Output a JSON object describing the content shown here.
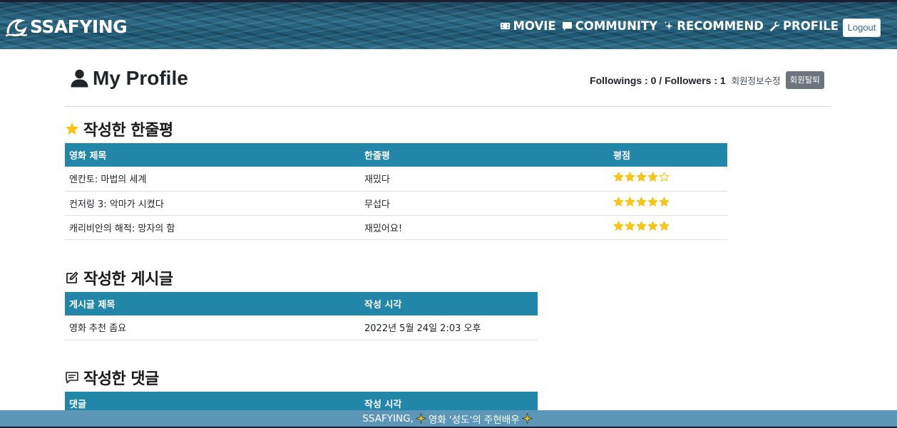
{
  "navbar": {
    "brand": "SSAFYING",
    "links": [
      {
        "label": "MOVIE",
        "icon": "film-icon"
      },
      {
        "label": "COMMUNITY",
        "icon": "chat-icon"
      },
      {
        "label": "RECOMMEND",
        "icon": "sparkle-icon"
      },
      {
        "label": "PROFILE",
        "icon": "wrench-icon"
      }
    ],
    "logout": "Logout"
  },
  "profile": {
    "title": "My Profile",
    "follow_text": "Followings : 0 / Followers : 1",
    "edit_label": "회원정보수정",
    "withdraw_label": "회원탈퇴"
  },
  "reviews": {
    "heading": "작성한 한줄평",
    "columns": [
      "영화 제목",
      "한줄평",
      "평점"
    ],
    "rows": [
      {
        "title": "엔칸토: 마법의 세계",
        "comment": "재밌다",
        "rating": 4
      },
      {
        "title": "컨저링 3: 악마가 시켰다",
        "comment": "무섭다",
        "rating": 5
      },
      {
        "title": "캐리비안의 해적: 망자의 함",
        "comment": "재밌어요!",
        "rating": 5
      }
    ]
  },
  "posts": {
    "heading": "작성한 게시글",
    "columns": [
      "게시글 제목",
      "작성 시각"
    ],
    "rows": [
      {
        "title": "영화 추천 좀요",
        "time": "2022년 5월 24일 2:03 오후"
      }
    ]
  },
  "comments": {
    "heading": "작성한 댓글",
    "columns": [
      "댓글",
      "작성 시각"
    ]
  },
  "footer": {
    "brand": "SSAFYING,",
    "text": "영화 '성도'의 주현배우"
  },
  "colors": {
    "table_header": "#2286a8",
    "star": "#f5c518",
    "footer": "#5d97b8"
  }
}
